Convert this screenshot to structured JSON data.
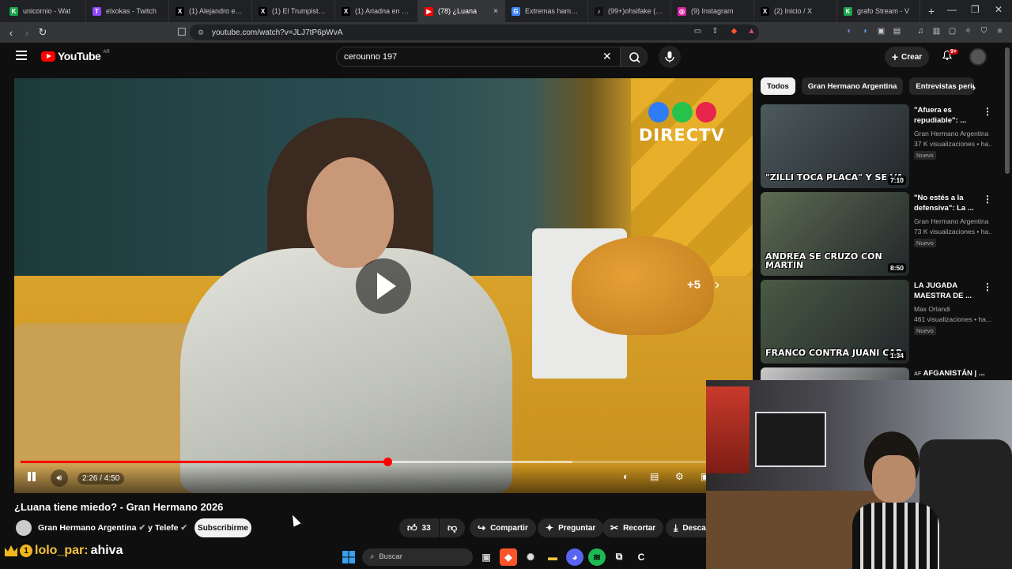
{
  "browser": {
    "tabs": [
      {
        "label": "unicornio - Wat",
        "icon_color": "#1aa34a",
        "icon": "K"
      },
      {
        "label": "elxokas - Twitch",
        "icon_color": "#9146ff",
        "icon": "T"
      },
      {
        "label": "(1) Alejandro en X:",
        "icon_color": "#000000",
        "icon": "X"
      },
      {
        "label": "(1) El Trumpista en",
        "icon_color": "#000000",
        "icon": "X"
      },
      {
        "label": "(1) Ariadna en X: \"n",
        "icon_color": "#000000",
        "icon": "X"
      },
      {
        "label": "(78) ¿Luana",
        "icon_color": "#ff0000",
        "icon": "▶",
        "active": true
      },
      {
        "label": "Extremas hamburg",
        "icon_color": "#4285f4",
        "icon": "G"
      },
      {
        "label": "(99+)ohsifake (@oh",
        "icon_color": "#111111",
        "icon": "♪"
      },
      {
        "label": "(9) Instagram",
        "icon_color": "#d6249f",
        "icon": "◎"
      },
      {
        "label": "(2) Inicio / X",
        "icon_color": "#000000",
        "icon": "X"
      },
      {
        "label": "grafo Stream - V",
        "icon_color": "#1aa34a",
        "icon": "K"
      }
    ],
    "close_tab": "×",
    "new_tab": "+",
    "url": "youtube.com/watch?v=JLJ7tP6pWvA"
  },
  "youtube": {
    "logo": "YouTube",
    "country": "AR",
    "search_query": "cerounno 197",
    "create_label": "Crear",
    "notif_count": "9+"
  },
  "player": {
    "overlay_brand": "DIRECTV",
    "skip_label": "+5",
    "time": "2:26 / 4:50",
    "progress": 0.505,
    "buffered": 0.76,
    "accent": "#ff0000"
  },
  "video": {
    "title": "¿Luana tiene miedo? - Gran Hermano 2026",
    "channel": "Gran Hermano Argentina",
    "channel_suffix": "y Telefe",
    "subscribe_label": "Subscribirme",
    "likes": "33",
    "share_label": "Compartir",
    "ask_label": "Preguntar",
    "clip_label": "Recortar",
    "download_label": "Desca"
  },
  "sidebar": {
    "chips": [
      "Todos",
      "Gran Hermano Argentina",
      "Entrevistas perio"
    ],
    "recommendations": [
      {
        "title": "\"Afuera es repudiable\": ...",
        "channel": "Gran Hermano Argentina",
        "views": "37 K visualizaciones • ha...",
        "badge": "Nuevo",
        "duration": "7:10",
        "thumb_text": "\"ZILLI TOCA PLACA\" Y SE VA",
        "thumb_color": "#4d5a5e"
      },
      {
        "title": "\"No estés a la defensiva\": La ...",
        "channel": "Gran Hermano Argentina",
        "views": "73 K visualizaciones • ha...",
        "badge": "Nuevo",
        "duration": "8:50",
        "thumb_text": "ANDREA SE CRUZO CON MARTIN",
        "thumb_color": "#5c6b52"
      },
      {
        "title": "LA JUGADA MAESTRA DE ...",
        "channel": "Max Orlandi",
        "views": "461 visualizaciones • ha...",
        "badge": "Nuevo",
        "duration": "1:34",
        "thumb_text": "FRANCO CONTRA JUANI CAR",
        "thumb_color": "#4a5a44"
      },
      {
        "title": "AFGANISTÁN | ...",
        "channel": "",
        "views": "",
        "badge": "",
        "duration": "",
        "thumb_text": "",
        "thumb_color": "#c9c9c9",
        "title_prefix": "AF"
      }
    ]
  },
  "chat": {
    "user": "lolo_par:",
    "message": "ahiva"
  },
  "taskbar": {
    "search_label": "Buscar"
  }
}
